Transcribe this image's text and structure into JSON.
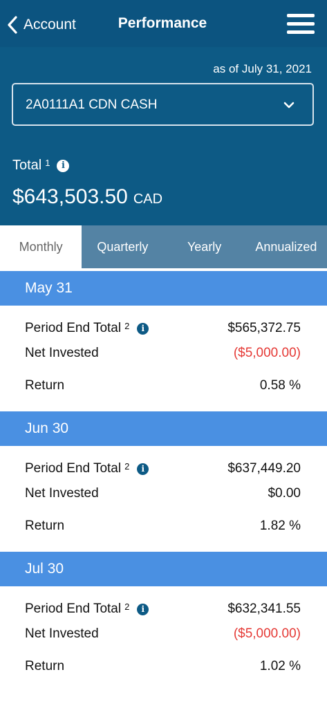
{
  "topbar": {
    "back_label": "Account",
    "title": "Performance",
    "back_icon": "chevron-left-icon",
    "menu_icon": "hamburger-menu-icon"
  },
  "header": {
    "as_of": "as of July 31, 2021",
    "account_selected": "2A0111A1 CDN CASH",
    "total_label": "Total",
    "total_footnote": "1",
    "total_amount": "$643,503.50",
    "total_currency": "CAD",
    "info_icon": "info-icon"
  },
  "tabs": [
    {
      "label": "Monthly",
      "active": true
    },
    {
      "label": "Quarterly",
      "active": false
    },
    {
      "label": "Yearly",
      "active": false
    },
    {
      "label": "Annualized",
      "active": false
    }
  ],
  "row_labels": {
    "period_end_total": "Period End Total",
    "footnote": "2",
    "net_invested": "Net Invested",
    "return": "Return"
  },
  "periods": [
    {
      "date": "May 31",
      "period_end_total": "$565,372.75",
      "net_invested": "($5,000.00)",
      "return": "0.58 %"
    },
    {
      "date": "Jun 30",
      "period_end_total": "$637,449.20",
      "net_invested": "$0.00",
      "return": "1.82 %"
    },
    {
      "date": "Jul 30",
      "period_end_total": "$632,341.55",
      "net_invested": "($5,000.00)",
      "return": "1.02 %"
    }
  ],
  "colors": {
    "header_bg": "#0d5a85",
    "tab_bar_bg": "#5483a4",
    "period_header_bg": "#4a90e2",
    "negative": "#e53935"
  }
}
